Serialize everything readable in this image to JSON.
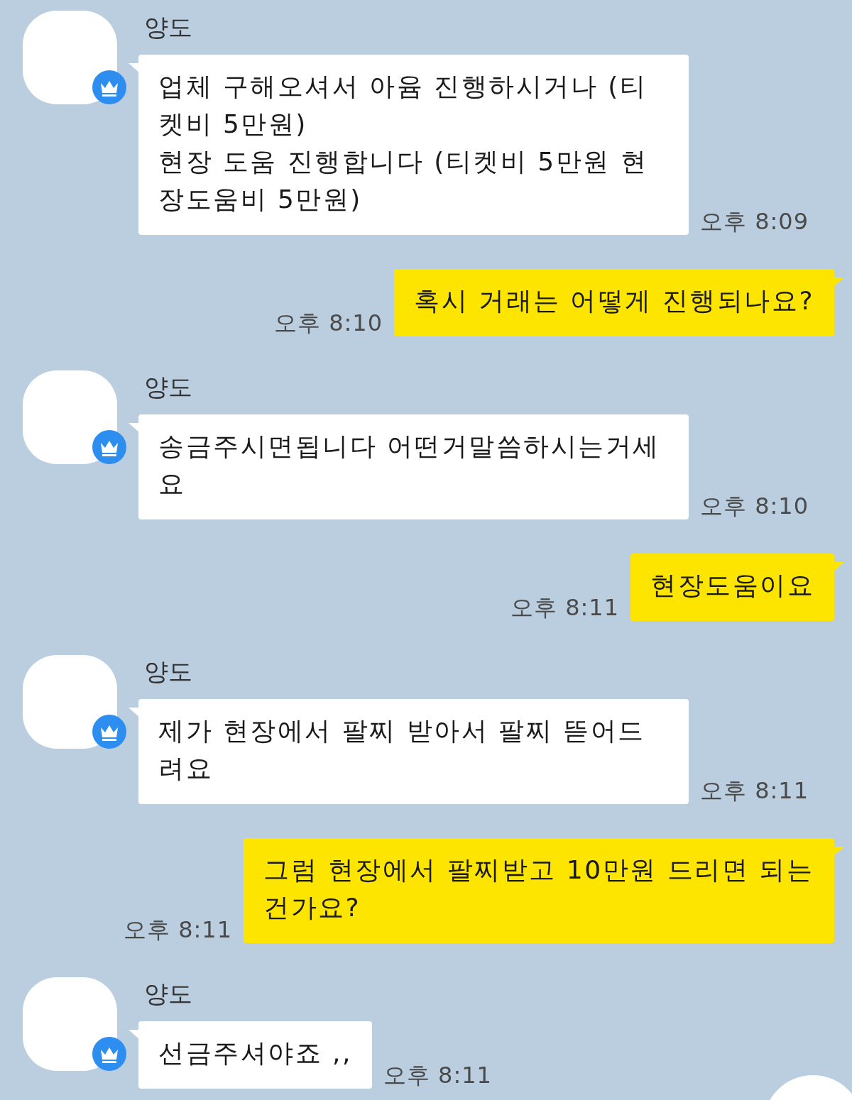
{
  "messages": [
    {
      "kind": "received",
      "sender": "양도",
      "text": "업체 구해오셔서 아윰 진행하시거나 (티켓비 5만원)\n현장 도움 진행합니다 (티켓비 5만원 현장도움비 5만원)",
      "time": "오후 8:09"
    },
    {
      "kind": "sent",
      "text": "혹시 거래는 어떻게 진행되나요?",
      "time": "오후 8:10"
    },
    {
      "kind": "received",
      "sender": "양도",
      "text": "송금주시면됩니다 어떤거말씀하시는거세요",
      "time": "오후 8:10"
    },
    {
      "kind": "sent",
      "text": "현장도움이요",
      "time": "오후 8:11"
    },
    {
      "kind": "received",
      "sender": "양도",
      "text": "제가 현장에서 팔찌 받아서 팔찌 뜯어드려요",
      "time": "오후 8:11"
    },
    {
      "kind": "sent",
      "text": "그럼 현장에서 팔찌받고 10만원 드리면 되는건가요?",
      "time": "오후 8:11"
    },
    {
      "kind": "received",
      "sender": "양도",
      "text": "선금주셔야죠 ,,",
      "time": "오후 8:11"
    }
  ]
}
